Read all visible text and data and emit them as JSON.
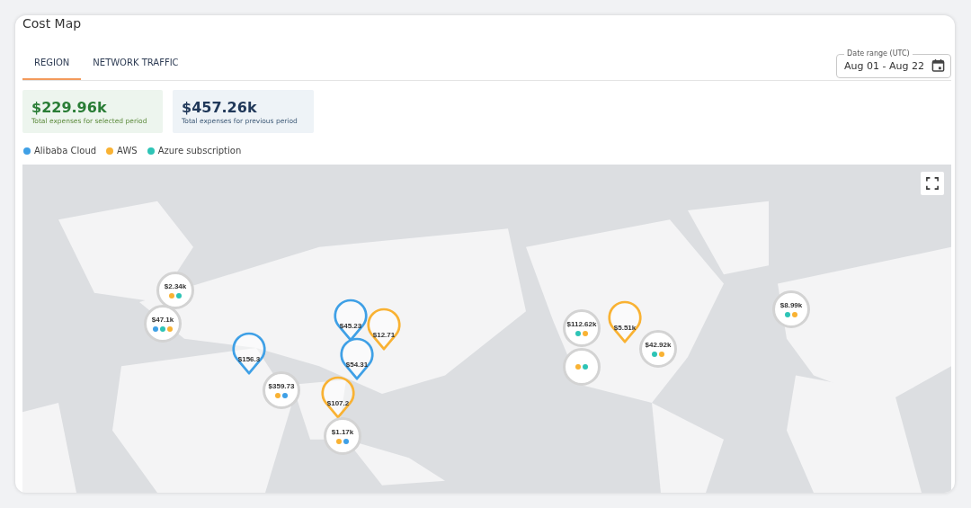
{
  "title": "Cost Map",
  "tabs": [
    {
      "label": "REGION",
      "selected": true
    },
    {
      "label": "NETWORK TRAFFIC",
      "selected": false
    }
  ],
  "date_range": {
    "label": "Date range (UTC)",
    "value": "Aug 01 - Aug 22"
  },
  "totals": [
    {
      "kind": "current",
      "amount": "$229.96k",
      "caption": "Total expenses for selected period"
    },
    {
      "kind": "previous",
      "amount": "$457.26k",
      "caption": "Total expenses for previous period"
    }
  ],
  "legend": [
    {
      "label": "Alibaba Cloud",
      "color": "#3fa0e6"
    },
    {
      "label": "AWS",
      "color": "#f9b233"
    },
    {
      "label": "Azure subscription",
      "color": "#2ec4b6"
    }
  ],
  "map": {
    "kind": "picture",
    "markers": [
      {
        "kind": "pin",
        "label": "$12.71",
        "color": "#f9b233"
      },
      {
        "kind": "pin",
        "label": "$45.23",
        "color": "#3fa0e6"
      },
      {
        "kind": "pin",
        "label": "$54.31",
        "color": "#3fa0e6"
      },
      {
        "kind": "pin",
        "label": "$107.2",
        "color": "#f9b233"
      },
      {
        "kind": "cluster",
        "label": "$1.17k",
        "dots": [
          {
            "color": "#f9b233"
          },
          {
            "color": "#3fa0e6"
          }
        ]
      },
      {
        "kind": "cluster",
        "label": "$2.34k",
        "dots": [
          {
            "color": "#f9b233"
          },
          {
            "color": "#2ec4b6"
          }
        ]
      },
      {
        "kind": "cluster",
        "label": "$47.1k",
        "dots": [
          {
            "color": "#3fa0e6"
          },
          {
            "color": "#2ec4b6"
          },
          {
            "color": "#f9b233"
          }
        ]
      },
      {
        "kind": "pin",
        "label": "$156.3",
        "color": "#3fa0e6"
      },
      {
        "kind": "cluster",
        "label": "$359.73",
        "dots": [
          {
            "color": "#f9b233"
          },
          {
            "color": "#3fa0e6"
          }
        ]
      },
      {
        "kind": "cluster",
        "dots": [
          {
            "color": "#f9b233"
          },
          {
            "color": "#2ec4b6"
          }
        ]
      },
      {
        "kind": "cluster",
        "label": "$112.62k",
        "dots": [
          {
            "color": "#2ec4b6"
          },
          {
            "color": "#f9b233"
          }
        ]
      },
      {
        "kind": "pin",
        "label": "$5.51k",
        "color": "#f9b233"
      },
      {
        "kind": "cluster",
        "label": "$42.92k",
        "dots": [
          {
            "color": "#2ec4b6"
          },
          {
            "color": "#f9b233"
          }
        ]
      },
      {
        "kind": "cluster",
        "label": "$8.99k",
        "dots": [
          {
            "color": "#2ec4b6"
          },
          {
            "color": "#f9b233"
          }
        ]
      }
    ]
  }
}
